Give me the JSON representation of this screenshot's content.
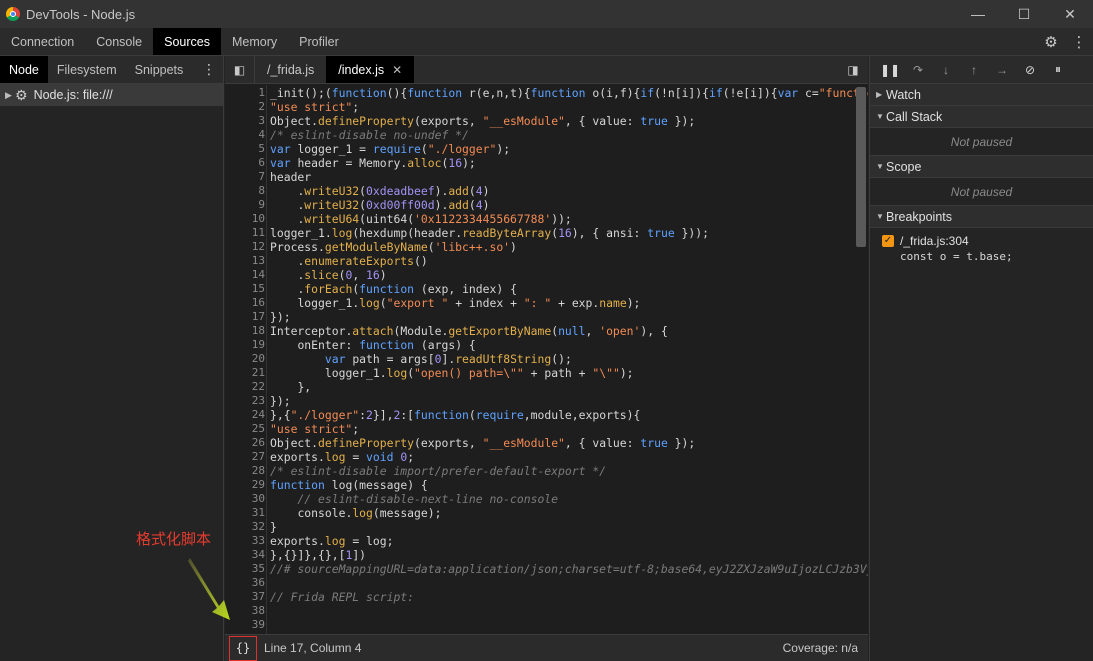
{
  "window": {
    "title": "DevTools - Node.js",
    "controls": [
      "—",
      "☐",
      "✕"
    ]
  },
  "main_tabs": [
    "Connection",
    "Console",
    "Sources",
    "Memory",
    "Profiler"
  ],
  "main_tab_active": "Sources",
  "navigator": {
    "tabs": [
      "Node",
      "Filesystem",
      "Snippets"
    ],
    "tree": [
      {
        "label": "Node.js: file:///"
      }
    ]
  },
  "editor": {
    "tabs": [
      {
        "label": "/_frida.js"
      },
      {
        "label": "/index.js",
        "active": true
      }
    ],
    "lines": [
      "_init();(function(){function r(e,n,t){function o(i,f){if(!n[i]){if(!e[i]){var c=\"function\"",
      "\"use strict\";",
      "Object.defineProperty(exports, \"__esModule\", { value: true });",
      "/* eslint-disable no-undef */",
      "var logger_1 = require(\"./logger\");",
      "var header = Memory.alloc(16);",
      "header",
      "    .writeU32(0xdeadbeef).add(4)",
      "    .writeU32(0xd00ff00d).add(4)",
      "    .writeU64(uint64('0x1122334455667788'));",
      "logger_1.log(hexdump(header.readByteArray(16), { ansi: true }));",
      "Process.getModuleByName('libc++.so')",
      "    .enumerateExports()",
      "    .slice(0, 16)",
      "    .forEach(function (exp, index) {",
      "    logger_1.log(\"export \" + index + \": \" + exp.name);",
      "});",
      "Interceptor.attach(Module.getExportByName(null, 'open'), {",
      "    onEnter: function (args) {",
      "        var path = args[0].readUtf8String();",
      "        logger_1.log(\"open() path=\\\"\" + path + \"\\\"\");",
      "    },",
      "});",
      "},{\"./logger\":2}],2:[function(require,module,exports){",
      "\"use strict\";",
      "Object.defineProperty(exports, \"__esModule\", { value: true });",
      "exports.log = void 0;",
      "/* eslint-disable import/prefer-default-export */",
      "function log(message) {",
      "    // eslint-disable-next-line no-console",
      "    console.log(message);",
      "}",
      "exports.log = log;",
      "},{}]},{},[1])",
      "//# sourceMappingURL=data:application/json;charset=utf-8;base64,eyJ2ZXJzaW9uIjozLCJzb3Vy",
      "",
      "// Frida REPL script:",
      "",
      ""
    ],
    "pretty_print": "{}",
    "cursor": "Line 17, Column 4",
    "coverage": "Coverage: n/a"
  },
  "debugger": {
    "watch": "Watch",
    "call_stack": "Call Stack",
    "call_stack_status": "Not paused",
    "scope": "Scope",
    "scope_status": "Not paused",
    "breakpoints": "Breakpoints",
    "breakpoint": {
      "file": "/_frida.js:304",
      "source": "const o = t.base;",
      "checked": true
    }
  },
  "annotation": {
    "label": "格式化脚本"
  },
  "colors": {
    "annotation": "#e63b2e",
    "arrow": "#b8d91a",
    "breakpoint": "#f29513"
  }
}
